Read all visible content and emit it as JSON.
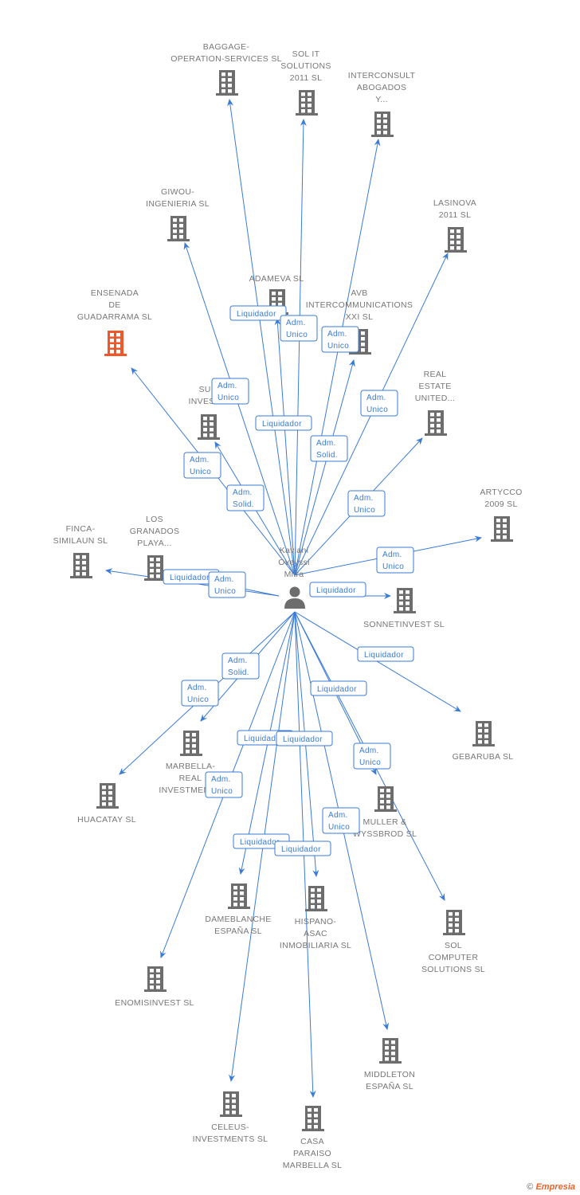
{
  "person": {
    "name_lines": [
      "Kaviani",
      "Oveyssi",
      "Mitra"
    ],
    "icon": "person-icon"
  },
  "colors": {
    "edge": "#3a7bd5",
    "node": "#6d6d6d",
    "highlight": "#f0582a",
    "label": "#777777"
  },
  "nodes": [
    {
      "lines": [
        "BAGGAGE-",
        "OPERATION-SERVICES SL"
      ]
    },
    {
      "lines": [
        "SOL IT",
        "SOLUTIONS",
        "2011 SL"
      ]
    },
    {
      "lines": [
        "INTERCONSULT",
        "ABOGADOS",
        "Y..."
      ]
    },
    {
      "lines": [
        "GIWOU-",
        "INGENIERIA SL"
      ]
    },
    {
      "lines": [
        "LASINOVA",
        "2011 SL"
      ]
    },
    {
      "lines": [
        "ADAMEVA SL"
      ]
    },
    {
      "lines": [
        "AVB",
        "INTERCOMMUNICATIONS",
        "XXI SL"
      ]
    },
    {
      "lines": [
        "ENSENADA",
        "DE",
        "GUADARRAMA SL"
      ],
      "highlight": true
    },
    {
      "lines": [
        "SUN",
        "INVEST 2"
      ]
    },
    {
      "lines": [
        "REAL",
        "ESTATE",
        "UNITED..."
      ]
    },
    {
      "lines": [
        "ARTYCCO",
        "2009 SL"
      ]
    },
    {
      "lines": [
        "FINCA-",
        "SIMILAUN SL"
      ]
    },
    {
      "lines": [
        "LOS",
        "GRANADOS",
        "PLAYA..."
      ]
    },
    {
      "lines": [
        "SONNETINVEST SL"
      ]
    },
    {
      "lines": [
        "GEBARUBA SL"
      ]
    },
    {
      "lines": [
        "MARBELLA-",
        "REAL",
        "INVESTMENT..."
      ]
    },
    {
      "lines": [
        "HUACATAY SL"
      ]
    },
    {
      "lines": [
        "MULLER &",
        "WYSSBROD SL"
      ]
    },
    {
      "lines": [
        "DAMEBLANCHE",
        "ESPAÑA SL"
      ]
    },
    {
      "lines": [
        "HISPANO-",
        "ASAC",
        "INMOBILIARIA SL"
      ]
    },
    {
      "lines": [
        "SOL",
        "COMPUTER",
        "SOLUTIONS SL"
      ]
    },
    {
      "lines": [
        "ENOMISINVEST SL"
      ]
    },
    {
      "lines": [
        "MIDDLETON",
        "ESPAÑA SL"
      ]
    },
    {
      "lines": [
        "CELEUS-",
        "INVESTMENTS SL"
      ]
    },
    {
      "lines": [
        "CASA",
        "PARAISO",
        "MARBELLA SL"
      ]
    }
  ],
  "edges": [
    {
      "target": 5,
      "role": [
        "Liquidador"
      ]
    },
    {
      "target": 1,
      "role": [
        "Adm.",
        "Unico"
      ]
    },
    {
      "target": 2,
      "role": [
        "Adm.",
        "Unico"
      ]
    },
    {
      "target": 3,
      "role": [
        "Adm.",
        "Unico"
      ]
    },
    {
      "target": 0,
      "role": [
        "Liquidador"
      ]
    },
    {
      "target": 4,
      "role": [
        "Adm.",
        "Unico"
      ]
    },
    {
      "target": 6,
      "role": [
        "Adm.",
        "Solid."
      ]
    },
    {
      "target": 7,
      "role": [
        "Adm.",
        "Unico"
      ]
    },
    {
      "target": 8,
      "role": [
        "Adm.",
        "Solid."
      ]
    },
    {
      "target": 9,
      "role": [
        "Adm.",
        "Unico"
      ]
    },
    {
      "target": 10,
      "role": [
        "Adm.",
        "Unico"
      ]
    },
    {
      "target": 11,
      "role": [
        "Liquidador"
      ]
    },
    {
      "target": 12,
      "role": [
        "Adm.",
        "Unico"
      ]
    },
    {
      "target": 13,
      "role": [
        "Liquidador"
      ]
    },
    {
      "target": 14,
      "role": [
        "Liquidador"
      ]
    },
    {
      "target": 15,
      "role": [
        "Adm.",
        "Solid."
      ]
    },
    {
      "target": 16,
      "role": [
        "Adm.",
        "Unico"
      ]
    },
    {
      "target": 17,
      "role": [
        "Liquidador"
      ]
    },
    {
      "target": 18,
      "role": [
        "Liquidador"
      ]
    },
    {
      "target": 19,
      "role": [
        "Liquidador"
      ]
    },
    {
      "target": 20,
      "role": [
        "Adm.",
        "Unico"
      ]
    },
    {
      "target": 21,
      "role": [
        "Adm.",
        "Unico"
      ]
    },
    {
      "target": 22,
      "role": [
        "Adm.",
        "Unico"
      ]
    },
    {
      "target": 23,
      "role": [
        "Liquidador"
      ]
    },
    {
      "target": 24,
      "role": [
        "Liquidador"
      ]
    }
  ],
  "copyright": {
    "symbol": "©",
    "brand": "Empresia"
  }
}
